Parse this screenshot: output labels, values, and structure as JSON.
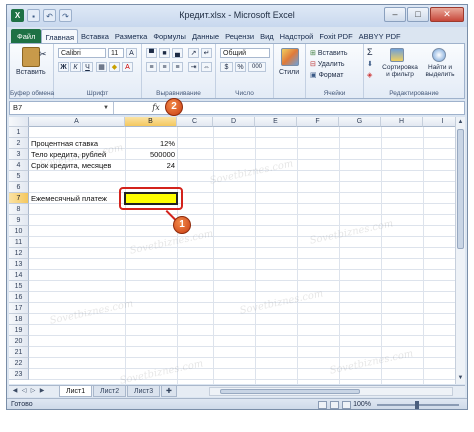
{
  "window": {
    "title": "Кредит.xlsx - Microsoft Excel",
    "controls": {
      "minimize": "–",
      "maximize": "□",
      "close": "✕"
    }
  },
  "quick_access": {
    "app": "X",
    "save": "▪",
    "undo": "↶",
    "redo": "↷"
  },
  "tabs": [
    "Файл",
    "Главная",
    "Вставка",
    "Разметка",
    "Формулы",
    "Данные",
    "Рецензи",
    "Вид",
    "Надстрой",
    "Foxit PDF",
    "ABBYY PDF"
  ],
  "ribbon": {
    "clipboard": {
      "paste": "Вставить",
      "label": "Буфер обмена"
    },
    "font": {
      "name": "Calibri",
      "size": "11",
      "bold": "Ж",
      "italic": "К",
      "underline": "Ч",
      "grow": "A",
      "label": "Шрифт"
    },
    "alignment": {
      "label": "Выравнивание"
    },
    "number": {
      "format": "Общий",
      "percent": "%",
      "thousands": "000",
      "label": "Число"
    },
    "styles": {
      "button": "Стили"
    },
    "cells": {
      "insert": "Вставить",
      "delete": "Удалить",
      "format": "Формат",
      "label": "Ячейки"
    },
    "editing": {
      "sort": "Сортировка и фильтр",
      "find": "Найти и выделить",
      "label": "Редактирование"
    }
  },
  "formula_bar": {
    "name_box": "B7",
    "fx": "fx",
    "formula": ""
  },
  "callouts": {
    "one": "1",
    "two": "2"
  },
  "columns": [
    "A",
    "B",
    "C",
    "D",
    "E",
    "F",
    "G",
    "H",
    "I"
  ],
  "rows": [
    "1",
    "2",
    "3",
    "4",
    "5",
    "6",
    "7",
    "8",
    "9",
    "10",
    "11",
    "12",
    "13",
    "14",
    "15",
    "16",
    "17",
    "18",
    "19",
    "20",
    "21",
    "22",
    "23"
  ],
  "cells": {
    "A2": "Процентная ставка",
    "B2": "12%",
    "A3": "Тело кредита, рублей",
    "B3": "500000",
    "A4": "Срок кредита, месяцев",
    "B4": "24",
    "A7": "Ежемесячный платеж",
    "B7": ""
  },
  "selected_cell": "B7",
  "watermark": "Sovetbiznes.com",
  "sheets": [
    "Лист1",
    "Лист2",
    "Лист3"
  ],
  "active_sheet": "Лист1",
  "status": {
    "ready": "Готово",
    "zoom": "100%"
  }
}
